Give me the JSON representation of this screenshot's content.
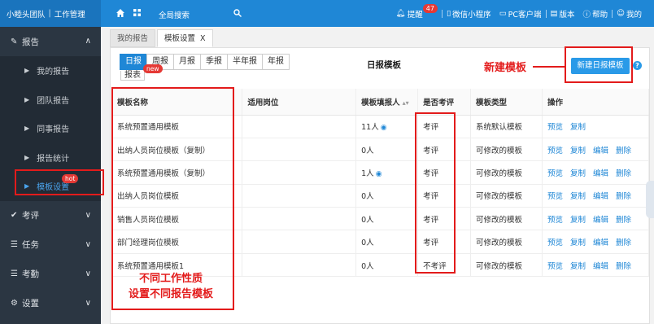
{
  "topbar": {
    "brand_team": "小睦头团队",
    "brand_sep": "|",
    "brand_section": "工作管理",
    "search_label": "全局搜索",
    "reminder_label": "提醒",
    "reminder_count": "47",
    "mini_program_label": "微信小程序",
    "pc_client_label": "PC客户端",
    "version_label": "版本",
    "help_label": "帮助",
    "mine_label": "我的"
  },
  "sidebar": {
    "report_group": "报告",
    "report_items": [
      {
        "label": "我的报告"
      },
      {
        "label": "团队报告"
      },
      {
        "label": "同事报告"
      },
      {
        "label": "报告统计"
      },
      {
        "label": "模板设置"
      }
    ],
    "hot_badge": "hot",
    "other_groups": [
      {
        "label": "考评",
        "icon": "check-icon"
      },
      {
        "label": "任务",
        "icon": "list-icon"
      },
      {
        "label": "考勤",
        "icon": "list-icon"
      },
      {
        "label": "设置",
        "icon": "gear-icon"
      }
    ]
  },
  "tabs": [
    {
      "label": "我的报告"
    },
    {
      "label": "模板设置"
    }
  ],
  "tab_close": "X",
  "panel": {
    "periods": [
      "日报",
      "周报",
      "月报",
      "季报",
      "半年报",
      "年报"
    ],
    "period_extra": "报表",
    "new_badge": "new",
    "title": "日报模板",
    "new_button": "新建日报模板",
    "help_symbol": "?"
  },
  "annotations": {
    "new_template": "新建模板",
    "bottom_line1": "不同工作性质",
    "bottom_line2": "设置不同报告模板"
  },
  "table": {
    "headers": [
      "模板名称",
      "适用岗位",
      "模板填报人",
      "是否考评",
      "模板类型",
      "操作"
    ],
    "rows": [
      {
        "name": "系统预置通用模板",
        "post": "",
        "fillers": "11人",
        "eye": true,
        "eval": "考评",
        "type": "系统默认模板",
        "actions": [
          "预览",
          "复制"
        ]
      },
      {
        "name": "出纳人员岗位模板（复制）",
        "post": "",
        "fillers": "0人",
        "eye": false,
        "eval": "考评",
        "type": "可修改的模板",
        "actions": [
          "预览",
          "复制",
          "编辑",
          "删除"
        ]
      },
      {
        "name": "系统预置通用模板（复制）",
        "post": "",
        "fillers": "1人",
        "eye": true,
        "eval": "考评",
        "type": "可修改的模板",
        "actions": [
          "预览",
          "复制",
          "编辑",
          "删除"
        ]
      },
      {
        "name": "出纳人员岗位模板",
        "post": "",
        "fillers": "0人",
        "eye": false,
        "eval": "考评",
        "type": "可修改的模板",
        "actions": [
          "预览",
          "复制",
          "编辑",
          "删除"
        ]
      },
      {
        "name": "销售人员岗位模板",
        "post": "",
        "fillers": "0人",
        "eye": false,
        "eval": "考评",
        "type": "可修改的模板",
        "actions": [
          "预览",
          "复制",
          "编辑",
          "删除"
        ]
      },
      {
        "name": "部门经理岗位模板",
        "post": "",
        "fillers": "0人",
        "eye": false,
        "eval": "考评",
        "type": "可修改的模板",
        "actions": [
          "预览",
          "复制",
          "编辑",
          "删除"
        ]
      },
      {
        "name": "系统预置通用模板1",
        "post": "",
        "fillers": "0人",
        "eye": false,
        "eval": "不考评",
        "type": "可修改的模板",
        "actions": [
          "预览",
          "复制",
          "编辑",
          "删除"
        ]
      }
    ]
  },
  "colors": {
    "primary": "#1f87d6",
    "sidebar_bg": "#2b3642",
    "annotation_red": "#e31b1b"
  }
}
